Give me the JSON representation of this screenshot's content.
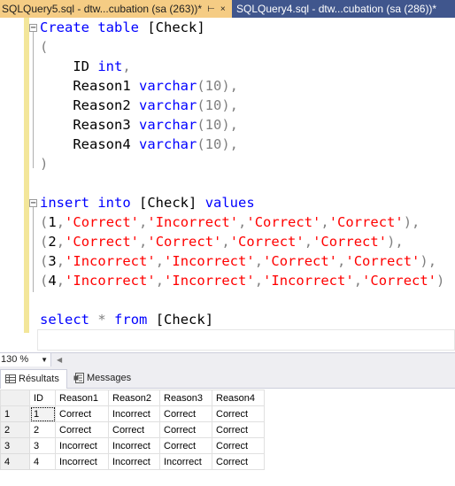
{
  "tabs": [
    {
      "label": "SQLQuery5.sql - dtw...cubation (sa (263))*",
      "pin": "⊢",
      "close": "×",
      "active": true
    },
    {
      "label": "SQLQuery4.sql - dtw...cubation (sa (286))*",
      "active": false
    }
  ],
  "editor": {
    "line1": {
      "kw1": "Create",
      "kw2": "table",
      "rest": " [Check]"
    },
    "line2": "(",
    "cols": [
      {
        "name": "ID",
        "type": "int",
        "args": "",
        "tail": ","
      },
      {
        "name": "Reason1",
        "type": "varchar",
        "args": "(10)",
        "tail": ","
      },
      {
        "name": "Reason2",
        "type": "varchar",
        "args": "(10)",
        "tail": ","
      },
      {
        "name": "Reason3",
        "type": "varchar",
        "args": "(10)",
        "tail": ","
      },
      {
        "name": "Reason4",
        "type": "varchar",
        "args": "(10)",
        "tail": ","
      }
    ],
    "close_paren": ")",
    "insert": {
      "kw1": "insert",
      "kw2": "into",
      "table": "[Check]",
      "kw3": "values"
    },
    "rows": [
      {
        "n": "1",
        "v": [
          "'Correct'",
          "'Incorrect'",
          "'Correct'",
          "'Correct'"
        ],
        "tail": "),"
      },
      {
        "n": "2",
        "v": [
          "'Correct'",
          "'Correct'",
          "'Correct'",
          "'Correct'"
        ],
        "tail": "),"
      },
      {
        "n": "3",
        "v": [
          "'Incorrect'",
          "'Incorrect'",
          "'Correct'",
          "'Correct'"
        ],
        "tail": "),"
      },
      {
        "n": "4",
        "v": [
          "'Incorrect'",
          "'Incorrect'",
          "'Incorrect'",
          "'Correct'"
        ],
        "tail": ")"
      }
    ],
    "select": {
      "kw1": "select",
      "star": "*",
      "kw2": "from",
      "table": "[Check]"
    }
  },
  "zoom": {
    "value": "130 %"
  },
  "results_tabs": [
    {
      "label": "Résultats",
      "active": true
    },
    {
      "label": "Messages",
      "active": false
    }
  ],
  "grid": {
    "columns": [
      "ID",
      "Reason1",
      "Reason2",
      "Reason3",
      "Reason4"
    ],
    "rows": [
      {
        "rownum": "1",
        "cells": [
          "1",
          "Correct",
          "Incorrect",
          "Correct",
          "Correct"
        ]
      },
      {
        "rownum": "2",
        "cells": [
          "2",
          "Correct",
          "Correct",
          "Correct",
          "Correct"
        ]
      },
      {
        "rownum": "3",
        "cells": [
          "3",
          "Incorrect",
          "Incorrect",
          "Correct",
          "Correct"
        ]
      },
      {
        "rownum": "4",
        "cells": [
          "4",
          "Incorrect",
          "Incorrect",
          "Incorrect",
          "Correct"
        ]
      }
    ]
  },
  "colors": {
    "tab_active": "#f5cc84",
    "tab_strip": "#40568d",
    "keyword": "#0000ff",
    "string": "#ff0000",
    "change_bar": "#f3e69a"
  }
}
